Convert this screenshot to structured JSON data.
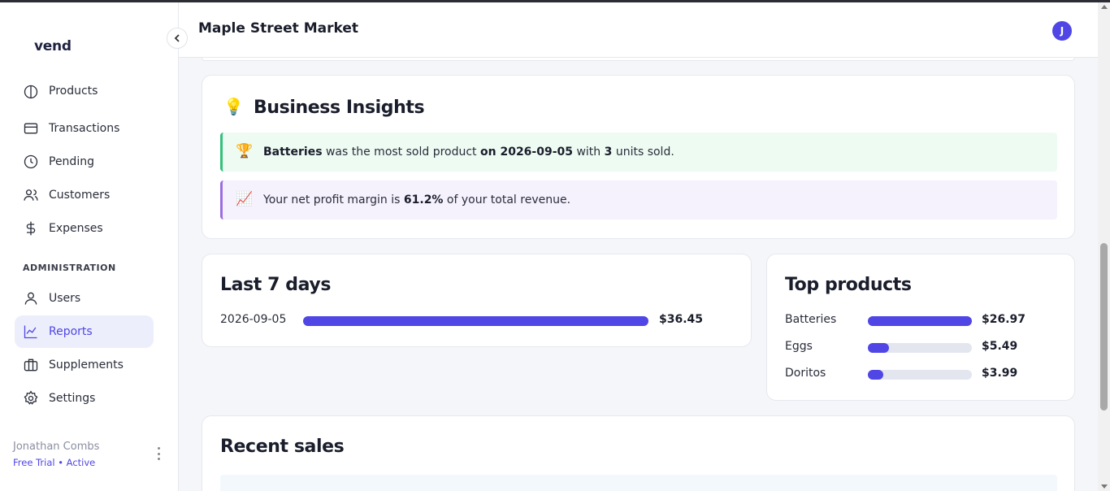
{
  "app": {
    "logo": "vend"
  },
  "header": {
    "title": "Maple Street Market",
    "avatar_initial": "J"
  },
  "sidebar": {
    "items": [
      {
        "label": "Products",
        "icon": "products-icon"
      },
      {
        "label": "Transactions",
        "icon": "card-icon"
      },
      {
        "label": "Pending",
        "icon": "clock-icon"
      },
      {
        "label": "Customers",
        "icon": "users-icon"
      },
      {
        "label": "Expenses",
        "icon": "dollar-icon"
      }
    ],
    "section_label": "ADMINISTRATION",
    "admin_items": [
      {
        "label": "Users",
        "icon": "user-icon"
      },
      {
        "label": "Reports",
        "icon": "chart-icon",
        "active": true
      },
      {
        "label": "Supplements",
        "icon": "briefcase-icon"
      },
      {
        "label": "Settings",
        "icon": "gear-icon"
      }
    ],
    "user": {
      "name": "Jonathan Combs",
      "plan": "Free Trial • Active"
    }
  },
  "insights": {
    "title": "Business Insights",
    "title_icon": "💡",
    "top_product": {
      "icon": "🏆",
      "product": "Batteries",
      "t1": " was the most sold product ",
      "date": "on 2026-09-05",
      "t2": " with ",
      "units": "3",
      "t3": " units sold."
    },
    "margin": {
      "icon": "📈",
      "t1": "Your net profit margin is ",
      "value": "61.2%",
      "t2": " of your total revenue."
    }
  },
  "last7": {
    "title": "Last 7 days",
    "rows": [
      {
        "date": "2026-09-05",
        "value": "$36.45",
        "fraction": 1.0
      }
    ]
  },
  "top_products": {
    "title": "Top products",
    "rows": [
      {
        "name": "Batteries",
        "value": "$26.97",
        "fraction": 1.0
      },
      {
        "name": "Eggs",
        "value": "$5.49",
        "fraction": 0.2
      },
      {
        "name": "Doritos",
        "value": "$3.99",
        "fraction": 0.15
      }
    ]
  },
  "recent_sales": {
    "title": "Recent sales"
  },
  "colors": {
    "accent": "#4f46e5",
    "active_bg": "#eceefb",
    "green": "#34c27a",
    "purple": "#9b6ee0"
  }
}
